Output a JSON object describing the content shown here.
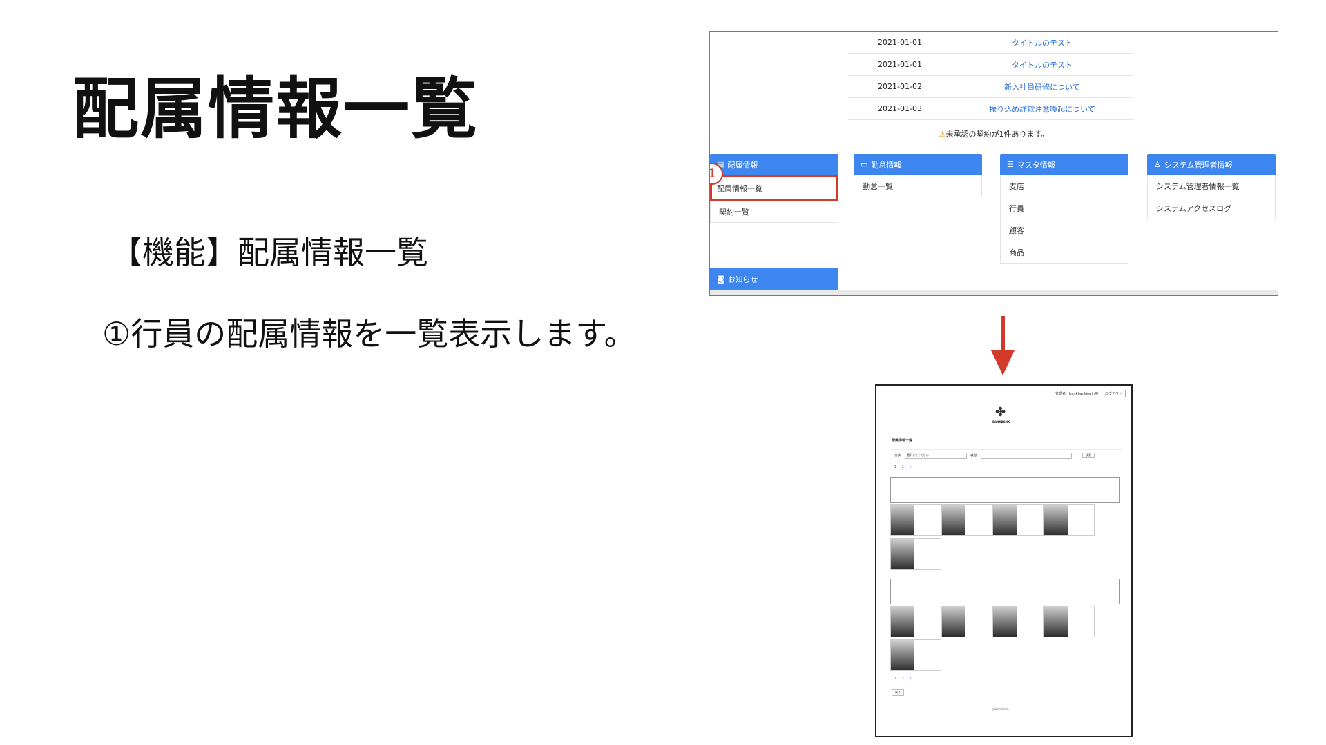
{
  "slide": {
    "title": "配属情報一覧",
    "feature": "【機能】配属情報一覧",
    "description": "①行員の配属情報を一覧表示します。"
  },
  "top_screenshot": {
    "notices": [
      {
        "date": "2021-01-01",
        "title": "タイトルのテスト"
      },
      {
        "date": "2021-01-01",
        "title": "タイトルのテスト"
      },
      {
        "date": "2021-01-02",
        "title": "新入社員研修について"
      },
      {
        "date": "2021-01-03",
        "title": "振り込め詐欺注意喚起について"
      }
    ],
    "alert": "未承認の契約が1件あります。",
    "cards": [
      {
        "header": "配属情報",
        "items": [
          "配属情報一覧",
          "契約一覧"
        ]
      },
      {
        "header": "勤怠情報",
        "items": [
          "勤怠一覧"
        ]
      },
      {
        "header": "マスタ情報",
        "items": [
          "支店",
          "行員",
          "顧客",
          "商品"
        ]
      },
      {
        "header": "システム管理者情報",
        "items": [
          "システム管理者情報一覧",
          "システムアクセスログ"
        ]
      }
    ],
    "news_header": "お知らせ",
    "step_badge": "1"
  },
  "bottom_screenshot": {
    "header_user": "管理者",
    "header_email": "bankbankingin4f",
    "logout": "ログアウト",
    "logo_text": "BANKBANK",
    "page_title": "配属情報一覧",
    "filter_branch_label": "支店",
    "filter_select": "選択してください",
    "filter_name_label": "名前",
    "search_button": "検索",
    "pagination": "1 2 »",
    "back_button": "戻る",
    "footer": "@bankbank"
  },
  "colors": {
    "accent_blue": "#3d86f0",
    "highlight_red": "#d23a2a",
    "link_blue": "#2a6fd6"
  }
}
